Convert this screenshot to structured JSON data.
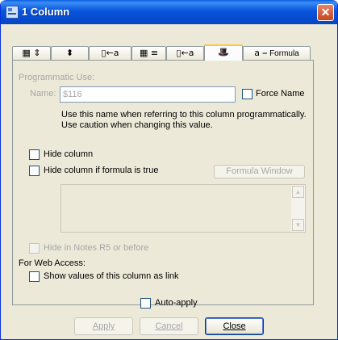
{
  "window": {
    "title": "1 Column"
  },
  "tabs": [
    {
      "name": "tab-width",
      "icon": "▦ ⇕"
    },
    {
      "name": "tab-sorting",
      "icon": "⬍"
    },
    {
      "name": "tab-column-font",
      "icon": "▯←a"
    },
    {
      "name": "tab-numbers",
      "icon": "▦ ≡"
    },
    {
      "name": "tab-title-font",
      "icon": "▯←a"
    },
    {
      "name": "tab-advanced",
      "icon": "🎩"
    },
    {
      "name": "tab-formula",
      "icon": "a ⎯",
      "label": "Formula"
    }
  ],
  "programmatic": {
    "heading": "Programmatic Use:",
    "name_label": "Name:",
    "name_value": "$116",
    "force_name_label": "Force Name",
    "help_line1": "Use this name when referring to this column programmatically.",
    "help_line2": "Use caution when changing this value."
  },
  "hide_column_label": "Hide column",
  "hide_if_formula_label": "Hide column if formula is true",
  "formula_window_label": "Formula Window",
  "hide_notes_r5_label": "Hide in Notes R5 or before",
  "web": {
    "heading": "For Web Access:",
    "show_link_label": "Show values of this column as link"
  },
  "auto_apply_label": "Auto-apply",
  "buttons": {
    "apply": "Apply",
    "cancel": "Cancel",
    "close": "Close"
  }
}
